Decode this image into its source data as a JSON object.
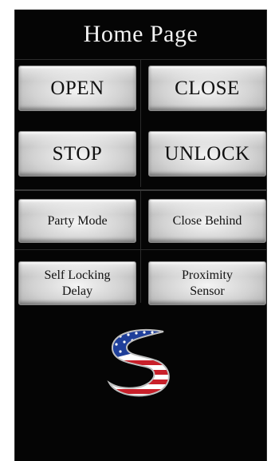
{
  "header": {
    "title": "Home Page"
  },
  "controls": {
    "open_label": "OPEN",
    "close_label": "CLOSE",
    "stop_label": "STOP",
    "unlock_label": "UNLOCK"
  },
  "modes": {
    "party_mode_label": "Party Mode",
    "close_behind_label": "Close Behind",
    "self_locking_delay_label": "Self Locking\nDelay",
    "proximity_sensor_label": "Proximity\nSensor"
  },
  "logo": {
    "icon": "american-flag-s-logo-icon",
    "colors": {
      "blue": "#1f3f9a",
      "red": "#c8202a",
      "white": "#ffffff",
      "silver": "#c0c0c0"
    }
  },
  "theme": {
    "background": "#050505",
    "title_color": "#f2f2f2",
    "button_face": "#d2d2d2",
    "button_text": "#111111"
  }
}
